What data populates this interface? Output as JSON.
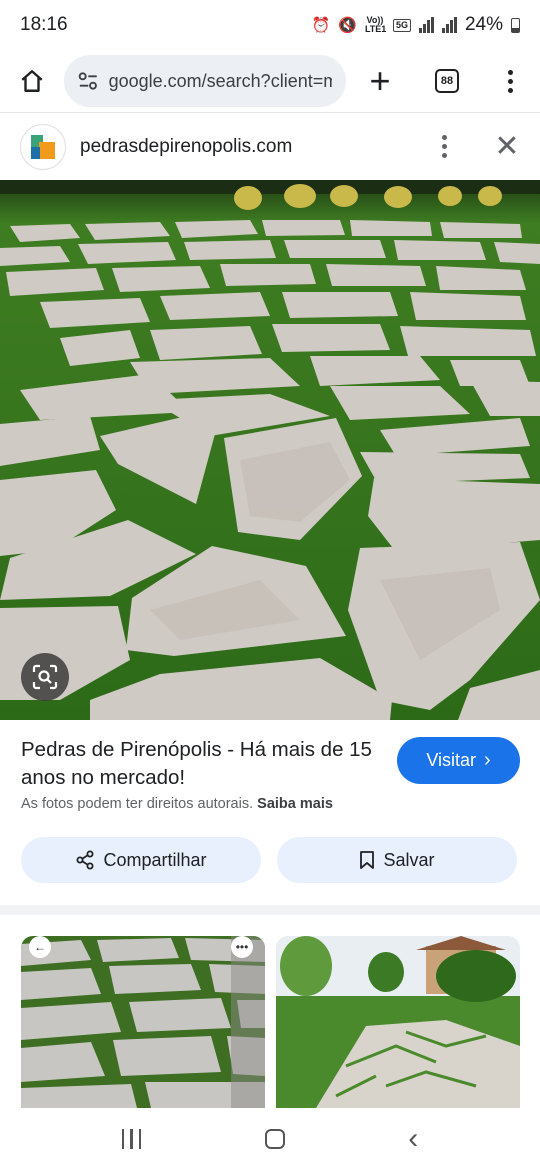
{
  "status_bar": {
    "time": "18:16",
    "volte_label": "Vo)) LTE1",
    "network_label": "5G",
    "battery": "24%"
  },
  "browser": {
    "url": "google.com/search?client=ms",
    "tab_count": "88"
  },
  "source": {
    "site_name": "pedrasdepirenopolis.com"
  },
  "result": {
    "title": "Pedras de Pirenópolis - Há mais de 15 anos no mercado!",
    "visit_label": "Visitar",
    "rights_text": "As fotos podem ter direitos autorais.",
    "learn_more": "Saiba mais",
    "share_label": "Compartilhar",
    "save_label": "Salvar"
  },
  "colors": {
    "accent": "#1a73e8",
    "pill_bg": "#e8f0fe",
    "grass": "#2f6a1c",
    "stone": "#d9d4cd"
  },
  "icons": [
    "home-icon",
    "site-settings-icon",
    "plus-icon",
    "tabs-icon",
    "more-icon",
    "close-icon",
    "lens-icon",
    "chevron-right-icon",
    "share-icon",
    "bookmark-icon"
  ]
}
